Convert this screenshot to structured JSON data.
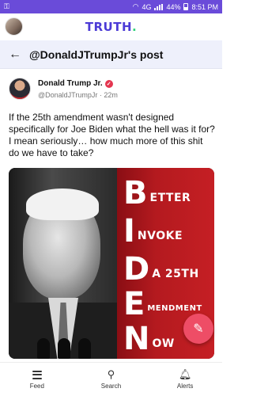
{
  "status_bar": {
    "left_icon": "vpn-key-icon",
    "network": "4G",
    "battery": "44%",
    "battery_level": 0.44,
    "time": "8:51 PM"
  },
  "app_bar": {
    "logo_text": "TRUTH",
    "logo_dot": ".",
    "logo_color": "#4c3bd6",
    "logo_dot_color": "#2fd27a"
  },
  "header": {
    "back_icon": "arrow-left-icon",
    "title": "@DonaldJTrumpJr's post"
  },
  "post": {
    "author_name": "Donald Trump Jr.",
    "verified_icon": "verified-badge-icon",
    "handle": "@DonaldJTrumpJr",
    "separator": "·",
    "time": "22m",
    "text": "If the 25th amendment wasn't designed specifically for Joe Biden what the hell was it for? I mean seriously… how much more of this shit do we have to take?",
    "image": {
      "lines": [
        {
          "initial": "B",
          "rest": "ETTER"
        },
        {
          "initial": "I",
          "rest": "NVOKE"
        },
        {
          "initial": "D",
          "rest": "A 25TH"
        },
        {
          "initial": "E",
          "rest": "MENDMENT"
        },
        {
          "initial": "N",
          "rest": "OW"
        }
      ],
      "panel_color": "#b41a1f"
    }
  },
  "fab": {
    "icon": "compose-sparkle-icon",
    "color": "#ee4d66"
  },
  "bottom_nav": [
    {
      "label": "Feed",
      "icon": "feed-icon"
    },
    {
      "label": "Search",
      "icon": "search-icon"
    },
    {
      "label": "Alerts",
      "icon": "bell-icon"
    }
  ]
}
